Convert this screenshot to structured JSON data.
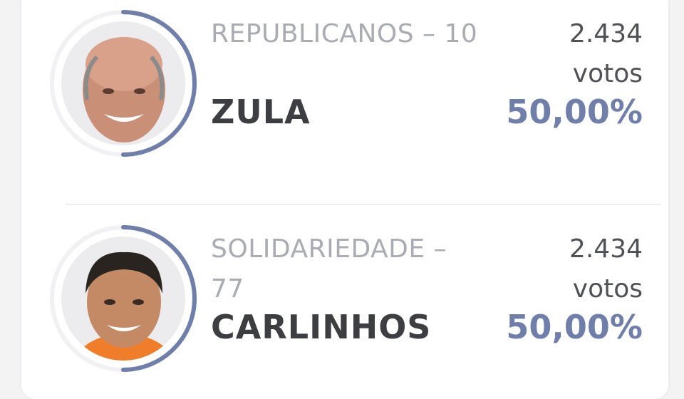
{
  "accent_color": "#6f7faa",
  "candidates": [
    {
      "party": "REPUBLICANOS – 10",
      "name": "ZULA",
      "votes_number": "2.434",
      "votes_unit": "votos",
      "percent": "50,00%",
      "share": 0.5,
      "photo_icon": "candidate-photo-icon"
    },
    {
      "party": "SOLIDARIEDADE – 77",
      "name": "CARLINHOS",
      "votes_number": "2.434",
      "votes_unit": "votos",
      "percent": "50,00%",
      "share": 0.5,
      "photo_icon": "candidate-photo-icon"
    }
  ]
}
